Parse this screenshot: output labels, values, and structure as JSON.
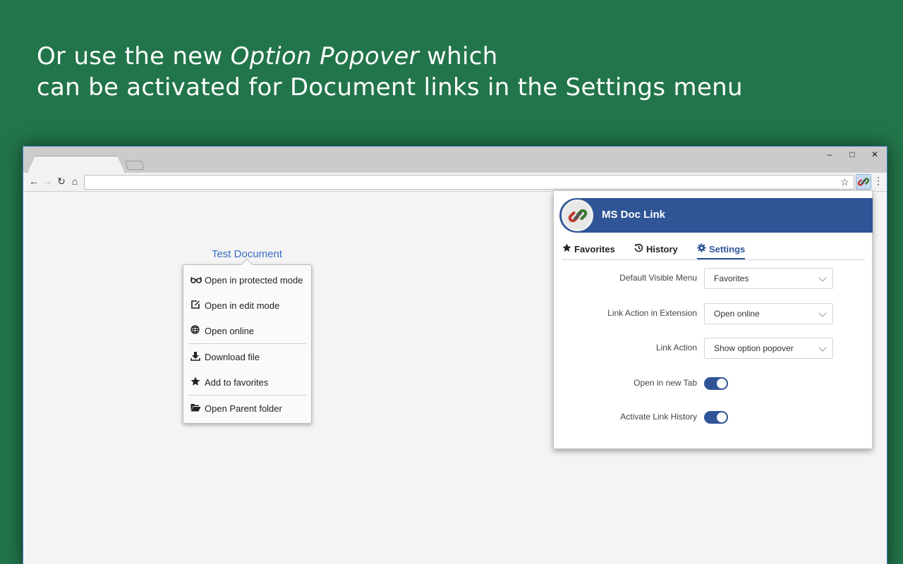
{
  "headline": {
    "line1_before": "Or use the new ",
    "line1_emph": "Option Popover",
    "line1_after": " which",
    "line2": "can be activated for Document links in the Settings menu"
  },
  "window_controls": {
    "minimize": "–",
    "maximize": "□",
    "close": "✕"
  },
  "toolbar": {
    "back": "←",
    "forward": "→",
    "reload": "↻",
    "home": "⌂",
    "bookmark": "☆",
    "menu": "⋮",
    "address": ""
  },
  "document_link": {
    "label": "Test Document"
  },
  "popover": {
    "items": [
      {
        "label": "Open in protected mode",
        "icon": "glasses-icon"
      },
      {
        "label": "Open in edit mode",
        "icon": "edit-icon"
      },
      {
        "label": "Open online",
        "icon": "globe-icon"
      },
      {
        "label": "Download file",
        "icon": "download-icon"
      },
      {
        "label": "Add to favorites",
        "icon": "star-icon"
      },
      {
        "label": "Open Parent folder",
        "icon": "folder-open-icon"
      }
    ]
  },
  "extension": {
    "title": "MS Doc Link",
    "accent": "#2f5597",
    "tabs": [
      {
        "label": "Favorites",
        "icon": "star-icon"
      },
      {
        "label": "History",
        "icon": "history-icon"
      },
      {
        "label": "Settings",
        "icon": "gear-icon",
        "active": true
      }
    ],
    "settings": {
      "default_visible_menu": {
        "label": "Default Visible Menu",
        "value": "Favorites"
      },
      "link_action_in_extension": {
        "label": "Link Action in Extension",
        "value": "Open online"
      },
      "link_action": {
        "label": "Link Action",
        "value": "Show option popover"
      },
      "open_in_new_tab": {
        "label": "Open in new Tab",
        "enabled": true
      },
      "activate_link_history": {
        "label": "Activate Link History",
        "enabled": true
      }
    }
  }
}
